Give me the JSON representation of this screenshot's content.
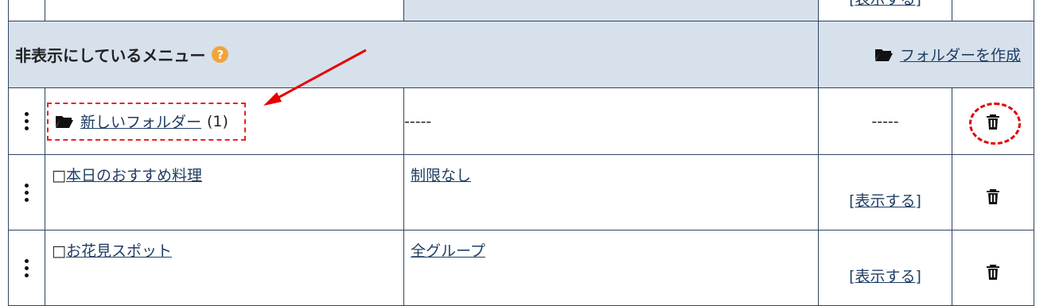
{
  "top_row": {
    "partial_link": "[表示する]"
  },
  "section": {
    "title": "非表示にしているメニュー",
    "help_icon_text": "?",
    "create_folder_label": "フォルダーを作成"
  },
  "rows": [
    {
      "type": "folder",
      "name": "新しいフォルダー",
      "count": "(1)",
      "restriction": "-----",
      "visibility": "-----"
    },
    {
      "type": "item",
      "checkbox": "□",
      "name": "本日のおすすめ料理",
      "restriction": "制限なし",
      "visibility_action": "[表示する]"
    },
    {
      "type": "item",
      "checkbox": "□",
      "name": "お花見スポット",
      "restriction": "全グループ",
      "visibility_action": "[表示する]"
    }
  ],
  "annotation_colors": {
    "highlight": "#e82424",
    "header_background": "#d7e1ec",
    "link": "#1f3e63"
  },
  "icons": [
    "folder-open-icon",
    "help-icon",
    "kebab-menu-icon",
    "trash-icon",
    "red-arrow"
  ]
}
